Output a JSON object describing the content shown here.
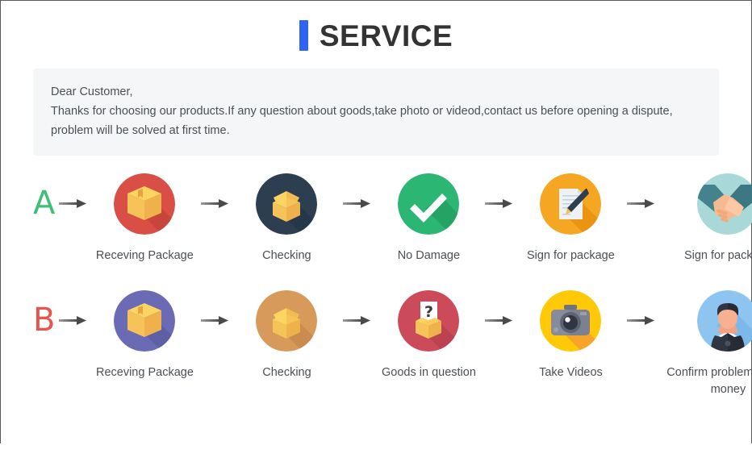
{
  "header": {
    "title": "SERVICE",
    "accent_color": "#2f64f3"
  },
  "notice": {
    "line1": "Dear Customer,",
    "line2": "Thanks for choosing our products.If any question about goods,take photo or videod,contact us before opening a dispute,",
    "line3": "problem will be solved at first time.",
    "background_color": "#f4f6f8"
  },
  "rows": [
    {
      "letter": "A",
      "letter_color": "#3cbf76",
      "steps": [
        {
          "label": "Receving Package",
          "icon": "closed-box-icon",
          "circle_color": "#d94f45"
        },
        {
          "label": "Checking",
          "icon": "open-box-icon",
          "circle_color": "#2c3e50"
        },
        {
          "label": "No Damage",
          "icon": "checkmark-icon",
          "circle_color": "#2cb673"
        },
        {
          "label": "Sign for package",
          "icon": "document-pen-icon",
          "circle_color": "#f5a623"
        },
        {
          "label": "Sign for package",
          "icon": "handshake-icon",
          "circle_color": "#a8d8d8"
        }
      ]
    },
    {
      "letter": "B",
      "letter_color": "#e8544e",
      "steps": [
        {
          "label": "Receving Package",
          "icon": "closed-box-icon",
          "circle_color": "#6b6bb5"
        },
        {
          "label": "Checking",
          "icon": "open-box-icon",
          "circle_color": "#d79a5b"
        },
        {
          "label": "Goods in question",
          "icon": "question-box-icon",
          "circle_color": "#cb4b5a"
        },
        {
          "label": "Take Videos",
          "icon": "camera-icon",
          "circle_color": "#ffc907"
        },
        {
          "label": "Confirm problem,refund money",
          "icon": "person-avatar-icon",
          "circle_color": "#8ec5f0"
        }
      ]
    }
  ],
  "arrow": {
    "name": "arrow-right-icon",
    "color": "#6b6b6b"
  }
}
